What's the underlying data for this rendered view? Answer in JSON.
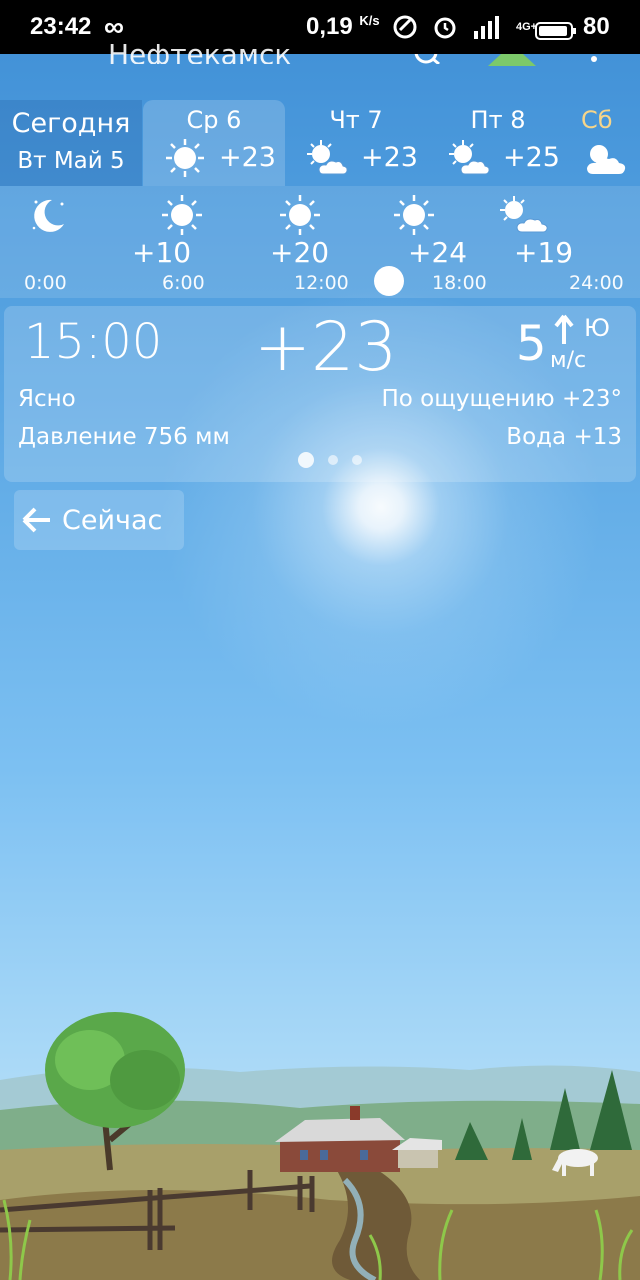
{
  "status_bar": {
    "time": "23:42",
    "infinity": "∞",
    "speed": "0,19",
    "speed_unit": "K/s",
    "network": "4G+",
    "battery": "80"
  },
  "header": {
    "city": "Нефтекамск"
  },
  "today_tab": {
    "line1": "Сегодня",
    "line2": "Вт Май 5"
  },
  "days": [
    {
      "name": "Ср 6",
      "temp": "+23",
      "icon": "sun-icon",
      "selected": true
    },
    {
      "name": "Чт 7",
      "temp": "+23",
      "icon": "sun-cloud-icon"
    },
    {
      "name": "Пт 8",
      "temp": "+25",
      "icon": "sun-cloud-icon"
    },
    {
      "name": "Сб",
      "temp": "",
      "icon": "sun-cloud-icon"
    }
  ],
  "hourly": {
    "temps": [
      "+10",
      "+20",
      "+24",
      "+19"
    ],
    "labels": [
      "0:00",
      "6:00",
      "12:00",
      "18:00",
      "24:00"
    ],
    "icons": [
      "moon-icon",
      "sun-icon",
      "sun-icon",
      "sun-icon",
      "sun-cloud-icon"
    ]
  },
  "detail": {
    "time": "15:00",
    "temp": "+23",
    "wind_speed": "5",
    "wind_unit": "м/с",
    "wind_dir": "Ю",
    "condition": "Ясно",
    "feels_like": "По ощущению +23°",
    "pressure": "Давление 756 мм",
    "water": "Вода +13"
  },
  "now_button": {
    "label": "Сейчас",
    "icon": "arrow-left-icon"
  },
  "colors": {
    "sky_top": "#3f8fd6",
    "sky_bottom": "#c9e7f8",
    "saturday": "#f6d58a"
  }
}
